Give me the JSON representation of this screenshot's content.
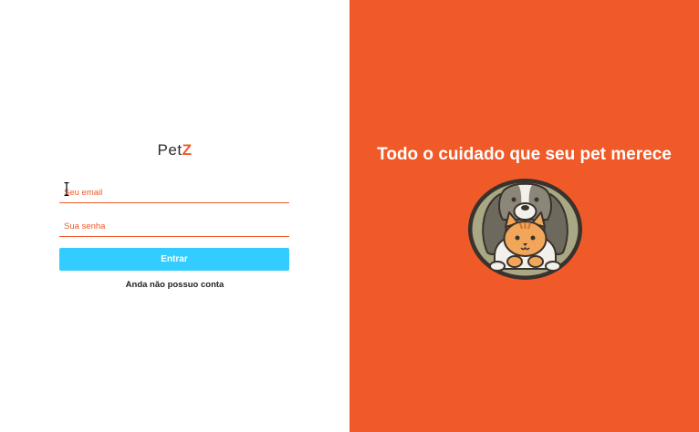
{
  "login": {
    "logo": {
      "part1": "Pet",
      "part2": "Z"
    },
    "email_placeholder": "Seu email",
    "password_placeholder": "Sua senha",
    "submit_label": "Entrar",
    "signup_link": "Anda não possuo conta"
  },
  "hero": {
    "tagline": "Todo o cuidado que seu pet merece",
    "illustration_icon": "dog-and-cat-icon"
  },
  "colors": {
    "brand_orange": "#f05a28",
    "button_blue": "#33ccff"
  }
}
